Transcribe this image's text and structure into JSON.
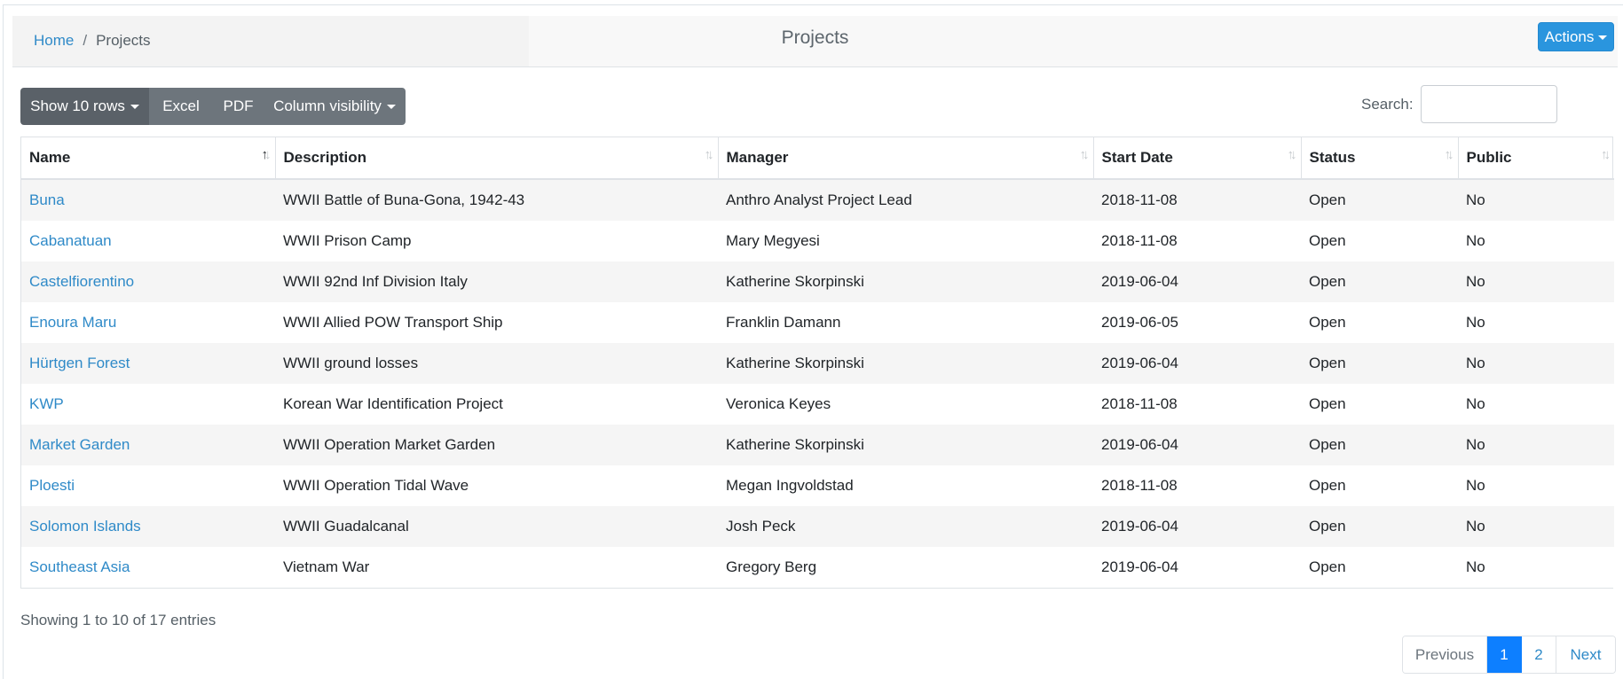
{
  "breadcrumb": {
    "home": "Home",
    "separator": "/",
    "current": "Projects"
  },
  "page_title": "Projects",
  "actions_label": "Actions",
  "toolbar": {
    "show_rows_label": "Show 10 rows",
    "excel_label": "Excel",
    "pdf_label": "PDF",
    "column_visibility_label": "Column visibility"
  },
  "search": {
    "label": "Search:",
    "value": "",
    "placeholder": ""
  },
  "table": {
    "columns": [
      "Name",
      "Description",
      "Manager",
      "Start Date",
      "Status",
      "Public"
    ],
    "sorted_column": "Name",
    "sort_direction": "ascending",
    "rows": [
      {
        "name": "Buna",
        "description": "WWII Battle of Buna-Gona, 1942-43",
        "manager": "Anthro Analyst Project Lead",
        "start_date": "2018-11-08",
        "status": "Open",
        "public": "No"
      },
      {
        "name": "Cabanatuan",
        "description": "WWII Prison Camp",
        "manager": "Mary Megyesi",
        "start_date": "2018-11-08",
        "status": "Open",
        "public": "No"
      },
      {
        "name": "Castelfiorentino",
        "description": "WWII 92nd Inf Division Italy",
        "manager": "Katherine Skorpinski",
        "start_date": "2019-06-04",
        "status": "Open",
        "public": "No"
      },
      {
        "name": "Enoura Maru",
        "description": "WWII Allied POW Transport Ship",
        "manager": "Franklin Damann",
        "start_date": "2019-06-05",
        "status": "Open",
        "public": "No"
      },
      {
        "name": "Hürtgen Forest",
        "description": "WWII ground losses",
        "manager": "Katherine Skorpinski",
        "start_date": "2019-06-04",
        "status": "Open",
        "public": "No"
      },
      {
        "name": "KWP",
        "description": "Korean War Identification Project",
        "manager": "Veronica Keyes",
        "start_date": "2018-11-08",
        "status": "Open",
        "public": "No"
      },
      {
        "name": "Market Garden",
        "description": "WWII Operation Market Garden",
        "manager": "Katherine Skorpinski",
        "start_date": "2019-06-04",
        "status": "Open",
        "public": "No"
      },
      {
        "name": "Ploesti",
        "description": "WWII Operation Tidal Wave",
        "manager": "Megan Ingvoldstad",
        "start_date": "2018-11-08",
        "status": "Open",
        "public": "No"
      },
      {
        "name": "Solomon Islands",
        "description": "WWII Guadalcanal",
        "manager": "Josh Peck",
        "start_date": "2019-06-04",
        "status": "Open",
        "public": "No"
      },
      {
        "name": "Southeast Asia",
        "description": "Vietnam War",
        "manager": "Gregory Berg",
        "start_date": "2019-06-04",
        "status": "Open",
        "public": "No"
      }
    ]
  },
  "info_text": "Showing 1 to 10 of 17 entries",
  "pagination": {
    "previous": "Previous",
    "pages": [
      "1",
      "2"
    ],
    "current_page": "1",
    "next": "Next"
  },
  "colors": {
    "link": "#2f8ac8",
    "actions_button": "#2a95de",
    "toolbar_button": "#6d757c",
    "active_page": "#0d7fff"
  },
  "icons": {
    "sort": "sort-arrows-icon",
    "dropdown": "caret-down-icon"
  }
}
